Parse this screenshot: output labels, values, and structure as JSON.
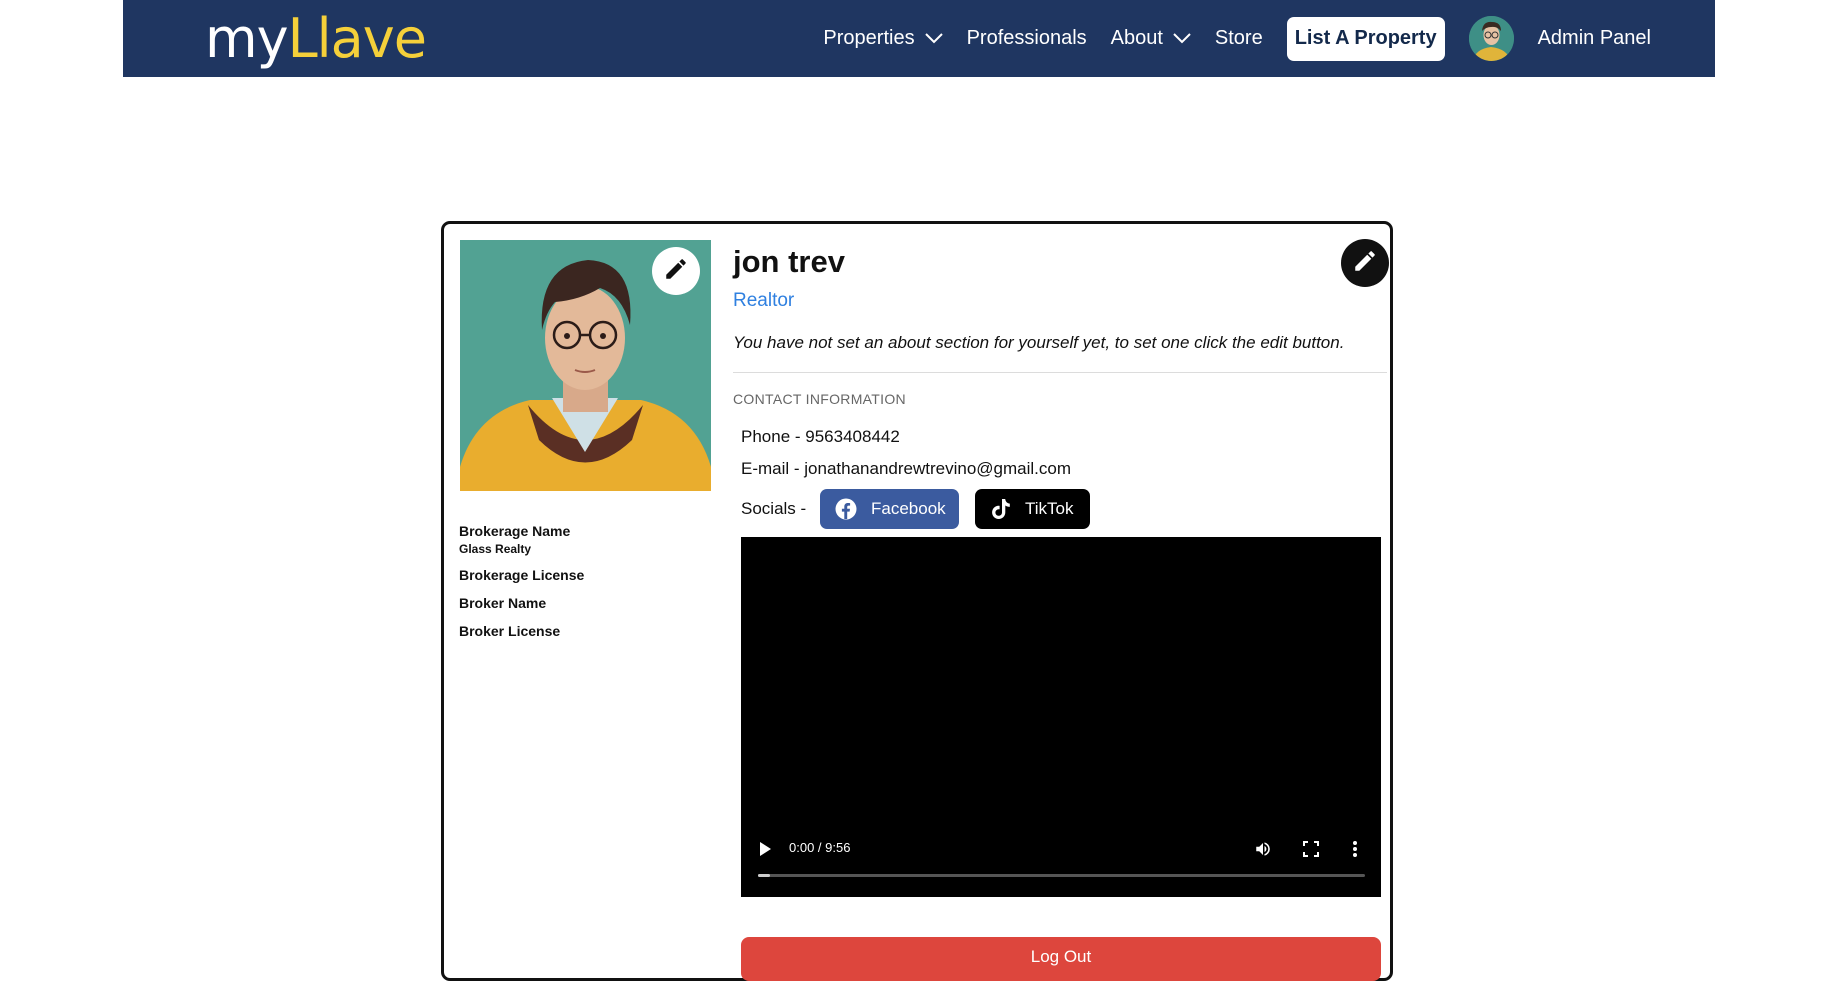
{
  "brand": {
    "part1": "my",
    "part2": "Llave"
  },
  "nav": {
    "properties": "Properties",
    "professionals": "Professionals",
    "about": "About",
    "store": "Store",
    "list_property": "List A Property",
    "admin_panel": "Admin Panel"
  },
  "profile": {
    "name": "jon trev",
    "role": "Realtor",
    "about": "You have not set an about section for yourself yet, to set one click the edit button.",
    "brokerage_name_label": "Brokerage Name",
    "brokerage_name_value": "Glass Realty",
    "brokerage_license_label": "Brokerage License",
    "broker_name_label": "Broker Name",
    "broker_license_label": "Broker License"
  },
  "contact": {
    "heading": "CONTACT INFORMATION",
    "phone": "Phone - 9563408442",
    "email": "E-mail - jonathanandrewtrevino@gmail.com",
    "socials_label": "Socials -",
    "facebook": "Facebook",
    "tiktok": "TikTok"
  },
  "video": {
    "time": "0:00 / 9:56",
    "progress": 0.02
  },
  "logout": "Log Out",
  "colors": {
    "navbar": "#1f3661",
    "brand_accent": "#f5d03a",
    "role": "#2f80e0",
    "facebook": "#3b5b9f",
    "logout": "#dd463d"
  },
  "icons": [
    "chevron-down-icon",
    "pencil-icon",
    "facebook-icon",
    "tiktok-icon",
    "play-icon",
    "volume-icon",
    "fullscreen-icon",
    "more-vert-icon"
  ]
}
